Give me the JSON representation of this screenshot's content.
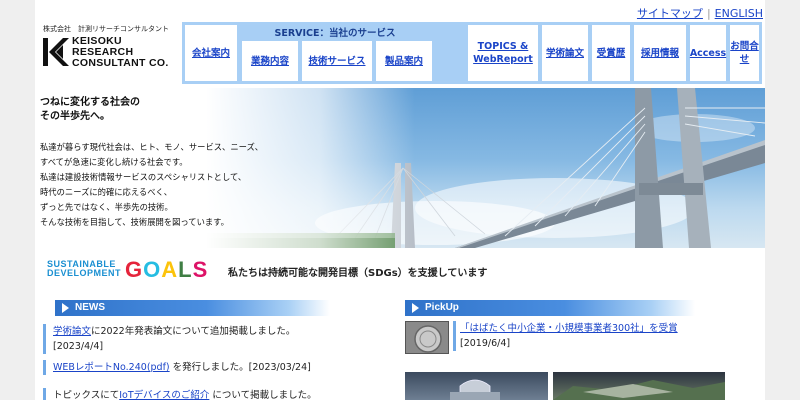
{
  "util_links": [
    "サイトマップ",
    "ENGLISH"
  ],
  "logo": {
    "kana": "株式会社　計測リサーチコンサルタント",
    "name_lines": [
      "KEISOKU",
      "RESEARCH",
      "CONSULTANT CO."
    ]
  },
  "nav": {
    "company": "会社案内",
    "service_heading": "SERVICE：当社のサービス",
    "services": [
      "業務内容",
      "技術サービス",
      "製品案内"
    ],
    "topics_line1": "TOPICS &",
    "topics_line2": "WebReport",
    "papers": "学術論文",
    "awards": "受賞歴",
    "recruit": "採用情報",
    "access": "Access",
    "contact": "お問合せ"
  },
  "hero": {
    "heading_line1": "つねに変化する社会の",
    "heading_line2": "その半歩先へ。",
    "body": [
      "私達が暮らす現代社会は、ヒト、モノ、サービス、ニーズ、",
      "すべてが急速に変化し続ける社会です。",
      "私達は建設技術情報サービスのスペシャリストとして、",
      "時代のニーズに的確に応えるべく、",
      "ずっと先ではなく、半歩先の技術。",
      "そんな技術を目指して、技術展開を図っています。"
    ]
  },
  "sdgs": {
    "line1": "SUSTAINABLE",
    "line2": "DEVELOPMENT",
    "goals_letters": [
      "G",
      "O",
      "A",
      "L",
      "S"
    ],
    "support_text": "私たちは持続可能な開発目標（SDGs）を支援しています"
  },
  "news": {
    "heading": "NEWS",
    "items": [
      {
        "link": "学術論文",
        "text": "に2022年発表論文について追加掲載しました。",
        "date": "[2023/4/4]"
      },
      {
        "link": "WEBレポートNo.240(pdf)",
        "text": " を発行しました。[2023/03/24]"
      },
      {
        "pre": "トピックスにて",
        "link": "IoTデバイスのご紹介",
        "text": " について掲載しました。"
      }
    ]
  },
  "pickup": {
    "heading": "PickUp",
    "item_link": "「はばたく中小企業・小規模事業者300社」を受賞",
    "item_date": "[2019/6/4]"
  },
  "colors": {
    "link": "#1a44c8",
    "nav_frame": "#a8cff5",
    "header_blue": "#2f72c9",
    "goals": [
      "#e5243b",
      "#26bde2",
      "#fcc30b",
      "#3f7e44",
      "#dd1367"
    ]
  }
}
